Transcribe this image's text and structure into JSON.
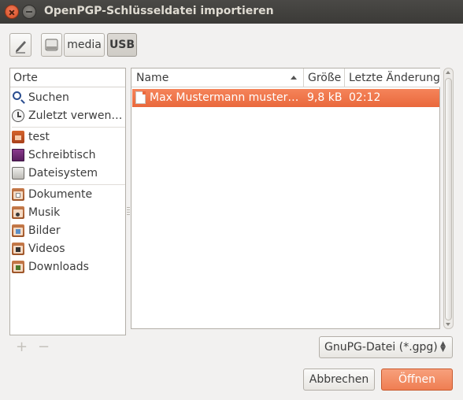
{
  "window": {
    "title": "OpenPGP-Schlüsseldatei importieren"
  },
  "pathbar": {
    "edit_icon": "pencil-icon",
    "segments": [
      {
        "label": "",
        "icon": "drive-icon"
      },
      {
        "label": "media"
      },
      {
        "label": "USB",
        "active": true
      }
    ]
  },
  "sidebar": {
    "header": "Orte",
    "items": [
      {
        "label": "Suchen",
        "icon": "search-icon"
      },
      {
        "label": "Zuletzt verwen…",
        "icon": "recent-icon"
      },
      {
        "label": "test",
        "icon": "home-folder-icon"
      },
      {
        "label": "Schreibtisch",
        "icon": "desktop-icon"
      },
      {
        "label": "Dateisystem",
        "icon": "filesystem-icon"
      },
      {
        "label": "Dokumente",
        "icon": "documents-folder-icon"
      },
      {
        "label": "Musik",
        "icon": "music-folder-icon"
      },
      {
        "label": "Bilder",
        "icon": "pictures-folder-icon"
      },
      {
        "label": "Videos",
        "icon": "videos-folder-icon"
      },
      {
        "label": "Downloads",
        "icon": "downloads-folder-icon"
      }
    ],
    "add_label": "+",
    "remove_label": "−"
  },
  "filelist": {
    "columns": {
      "name": "Name",
      "size": "Größe",
      "modified": "Letzte Änderung"
    },
    "rows": [
      {
        "name": "Max Mustermann muster…",
        "size": "9,8 kB",
        "modified": "02:12",
        "selected": true
      }
    ]
  },
  "filter": {
    "selected": "GnuPG-Datei (*.gpg)"
  },
  "buttons": {
    "cancel": "Abbrechen",
    "open": "Öffnen"
  },
  "colors": {
    "accent": "#ef7e52",
    "titlebar": "#3c3b37",
    "selection": "#f07746"
  }
}
